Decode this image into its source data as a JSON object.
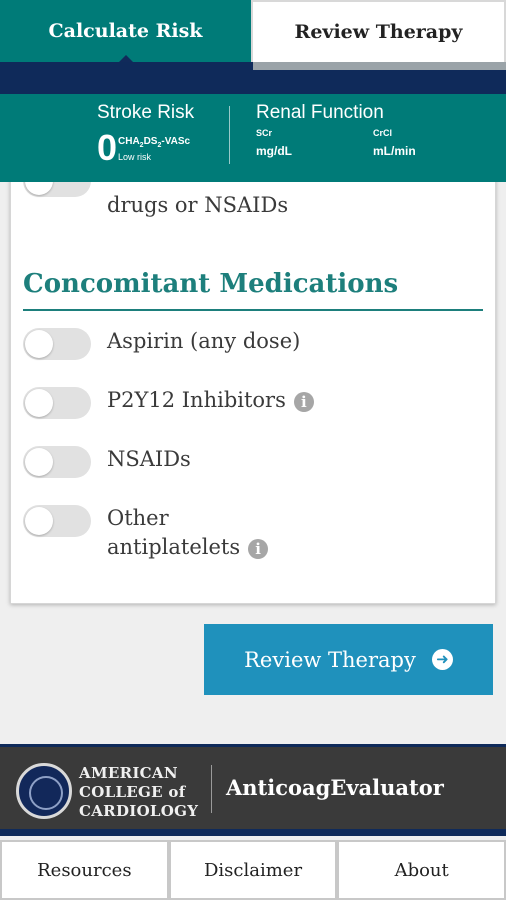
{
  "tabs": {
    "calculate": "Calculate Risk",
    "review": "Review Therapy"
  },
  "risk_bar": {
    "stroke_title": "Stroke Risk",
    "score": "0",
    "score_label": "CHA2DS2-VASc",
    "score_note": "Low risk",
    "renal_title": "Renal Function",
    "scr_label": "SCr",
    "scr_unit": "mg/dL",
    "crcl_label": "CrCl",
    "crcl_unit": "mL/min"
  },
  "cut_option": {
    "line2": "drugs or NSAIDs"
  },
  "concomitant": {
    "title": "Concomitant Medications",
    "options": [
      {
        "label": "Aspirin (any dose)",
        "on": false
      },
      {
        "label": "P2Y12 Inhibitors",
        "on": false,
        "info": true
      },
      {
        "label": "NSAIDs",
        "on": false
      },
      {
        "label": "Other",
        "label2": "antiplatelets",
        "on": false,
        "info": true
      }
    ]
  },
  "review_button": "Review Therapy",
  "footer": {
    "org_line1": "AMERICAN",
    "org_line2": "COLLEGE of",
    "org_line3": "CARDIOLOGY",
    "app_name": "AnticoagEvaluator"
  },
  "bottom_nav": {
    "resources": "Resources",
    "disclaimer": "Disclaimer",
    "about": "About"
  },
  "colors": {
    "teal": "#007b78",
    "navy": "#0f2a5a",
    "button_blue": "#1f91bc"
  }
}
